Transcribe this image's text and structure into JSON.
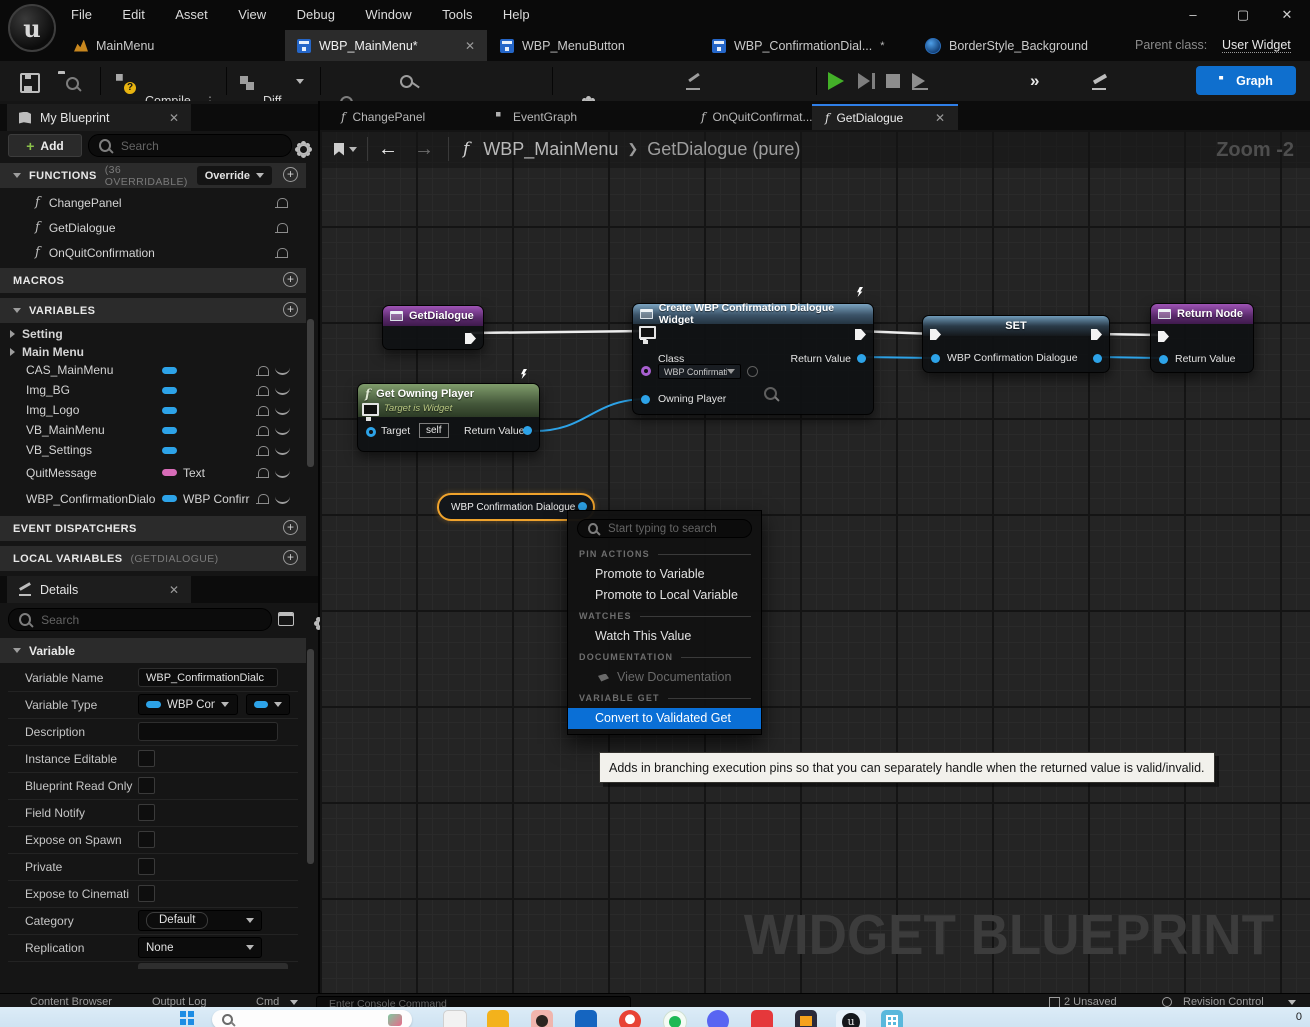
{
  "colors": {
    "accent_blue": "#0f6fce",
    "menu_highlight": "#0a6fd6",
    "pin_blue": "#2da3e8",
    "pill_pink": "#d86cb8",
    "selection_orange": "#f0a32c",
    "exec_wire": "#f0f0f0",
    "node_green": "#44573a",
    "node_purple": "#5a2a6c",
    "node_blue": "#3b5368",
    "tooltip_bg": "#f2f1ec",
    "taskbar_bg": "#cfe3f2"
  },
  "titlebar": {
    "menus": [
      "File",
      "Edit",
      "Asset",
      "View",
      "Debug",
      "Window",
      "Tools",
      "Help"
    ],
    "minimize": "–",
    "maximize": "▢",
    "close": "✕"
  },
  "asset_tabs": {
    "tab_mainmenu": "MainMenu",
    "tab_wbp_mainmenu": "WBP_MainMenu*",
    "tab_wbp_menubutton": "WBP_MenuButton",
    "tab_wbp_confirmation": "WBP_ConfirmationDial...",
    "tab_wbp_confirmation_dirty": "*",
    "tab_borderstyle": "BorderStyle_Background",
    "parent_class_label": "Parent class:",
    "parent_class_value": "User Widget"
  },
  "toolbar": {
    "compile": "Compile",
    "diff": "Diff",
    "find": "Find",
    "hide_unrelated": "Hide Unrelated",
    "class_settings": "Class Settings",
    "class_defaults": "Class Defaults",
    "designer": "Designer",
    "graph": "Graph"
  },
  "my_blueprint": {
    "title": "My Blueprint",
    "add": "Add",
    "search_placeholder": "Search",
    "functions_header": "FUNCTIONS",
    "functions_meta": "(36 OVERRIDABLE)",
    "override": "Override",
    "functions": [
      "ChangePanel",
      "GetDialogue",
      "OnQuitConfirmation"
    ],
    "macros_header": "MACROS",
    "variables_header": "VARIABLES",
    "category_setting": "Setting",
    "category_mainmenu": "Main Menu",
    "variables": [
      {
        "name": "CAS_MainMenu",
        "type": ""
      },
      {
        "name": "Img_BG",
        "type": ""
      },
      {
        "name": "Img_Logo",
        "type": ""
      },
      {
        "name": "VB_MainMenu",
        "type": ""
      },
      {
        "name": "VB_Settings",
        "type": ""
      },
      {
        "name": "QuitMessage",
        "type": "Text"
      },
      {
        "name": "WBP_ConfirmationDialo",
        "type": "WBP Confirr"
      }
    ],
    "event_dispatchers_header": "EVENT DISPATCHERS",
    "local_variables_header": "LOCAL VARIABLES",
    "local_variables_meta": "(GETDIALOGUE)"
  },
  "details": {
    "title": "Details",
    "search_placeholder": "Search",
    "section": "Variable",
    "variable_name_label": "Variable Name",
    "variable_name_value": "WBP_ConfirmationDialc",
    "variable_type_label": "Variable Type",
    "variable_type_value": "WBP Con",
    "description_label": "Description",
    "checkbox_rows": [
      "Instance Editable",
      "Blueprint Read Only",
      "Field Notify",
      "Expose on Spawn",
      "Private",
      "Expose to Cinemati"
    ],
    "category_label": "Category",
    "category_value": "Default",
    "replication_label": "Replication",
    "replication_value": "None"
  },
  "graph": {
    "tabs": [
      "ChangePanel",
      "EventGraph",
      "OnQuitConfirmat...",
      "GetDialogue"
    ],
    "breadcrumb_root": "WBP_MainMenu",
    "breadcrumb_sep": "❯",
    "breadcrumb_leaf": "GetDialogue (pure)",
    "zoom_label": "Zoom -2",
    "watermark": "WIDGET BLUEPRINT",
    "nodes": {
      "entry": {
        "title": "GetDialogue"
      },
      "get_owning_player": {
        "title": "Get Owning Player",
        "subtitle": "Target is Widget",
        "target_label": "Target",
        "target_value": "self",
        "return_label": "Return Value"
      },
      "create_widget": {
        "title": "Create WBP Confirmation Dialogue Widget",
        "class_label": "Class",
        "class_value": "WBP Confirmati",
        "owning_player_label": "Owning Player",
        "return_label": "Return Value"
      },
      "set": {
        "title": "SET",
        "pin_label": "WBP Confirmation Dialogue"
      },
      "return_node": {
        "title": "Return Node",
        "pin_label": "Return Value"
      },
      "var_get": {
        "title": "WBP Confirmation Dialogue"
      }
    },
    "context_menu": {
      "search_placeholder": "Start typing to search",
      "sec_pin_actions": "PIN ACTIONS",
      "item_promote_var": "Promote to Variable",
      "item_promote_local": "Promote to Local Variable",
      "sec_watches": "WATCHES",
      "item_watch": "Watch This Value",
      "sec_documentation": "DOCUMENTATION",
      "item_view_doc": "View Documentation",
      "sec_variable_get": "VARIABLE GET",
      "item_convert": "Convert to Validated Get"
    },
    "tooltip": "Adds in branching execution pins so that you can separately handle when the returned value is valid/invalid."
  },
  "statusbar": {
    "content_browser": "Content Browser",
    "output_log": "Output Log",
    "cmd": "Cmd",
    "console_placeholder": "Enter Console Command",
    "unsaved": "2 Unsaved",
    "revision_control": "Revision Control"
  },
  "taskbar": {
    "badge": "0"
  }
}
